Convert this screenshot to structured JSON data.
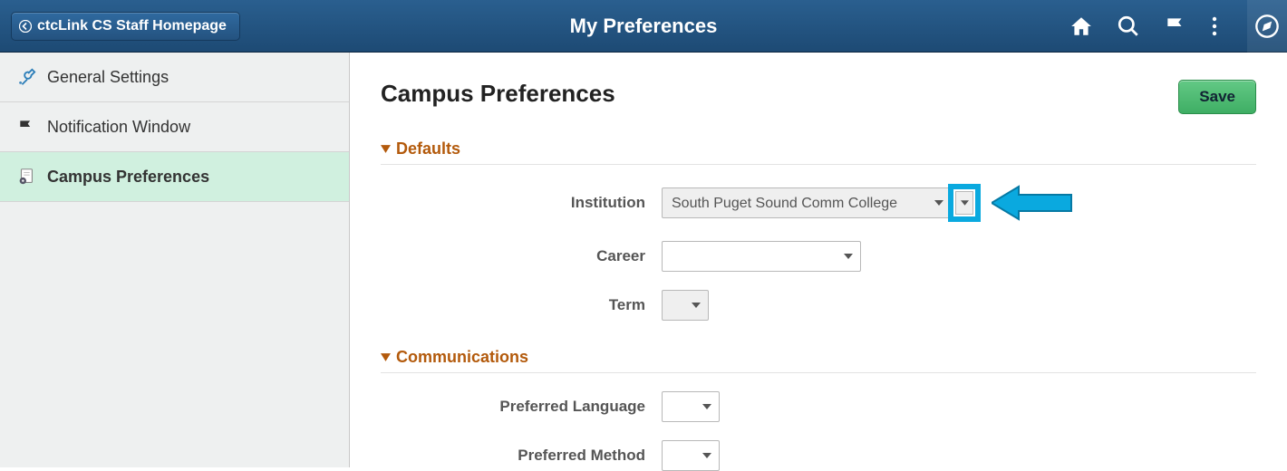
{
  "header": {
    "back_label": "ctcLink CS Staff Homepage",
    "title": "My Preferences"
  },
  "sidebar": {
    "items": [
      {
        "label": "General Settings"
      },
      {
        "label": "Notification Window"
      },
      {
        "label": "Campus Preferences"
      }
    ]
  },
  "content": {
    "title": "Campus Preferences",
    "save_label": "Save",
    "sections": {
      "defaults": {
        "heading": "Defaults",
        "institution_label": "Institution",
        "institution_value": "South Puget Sound Comm College",
        "career_label": "Career",
        "career_value": "",
        "term_label": "Term",
        "term_value": ""
      },
      "communications": {
        "heading": "Communications",
        "pref_lang_label": "Preferred Language",
        "pref_lang_value": "",
        "pref_method_label": "Preferred Method",
        "pref_method_value": ""
      }
    }
  }
}
